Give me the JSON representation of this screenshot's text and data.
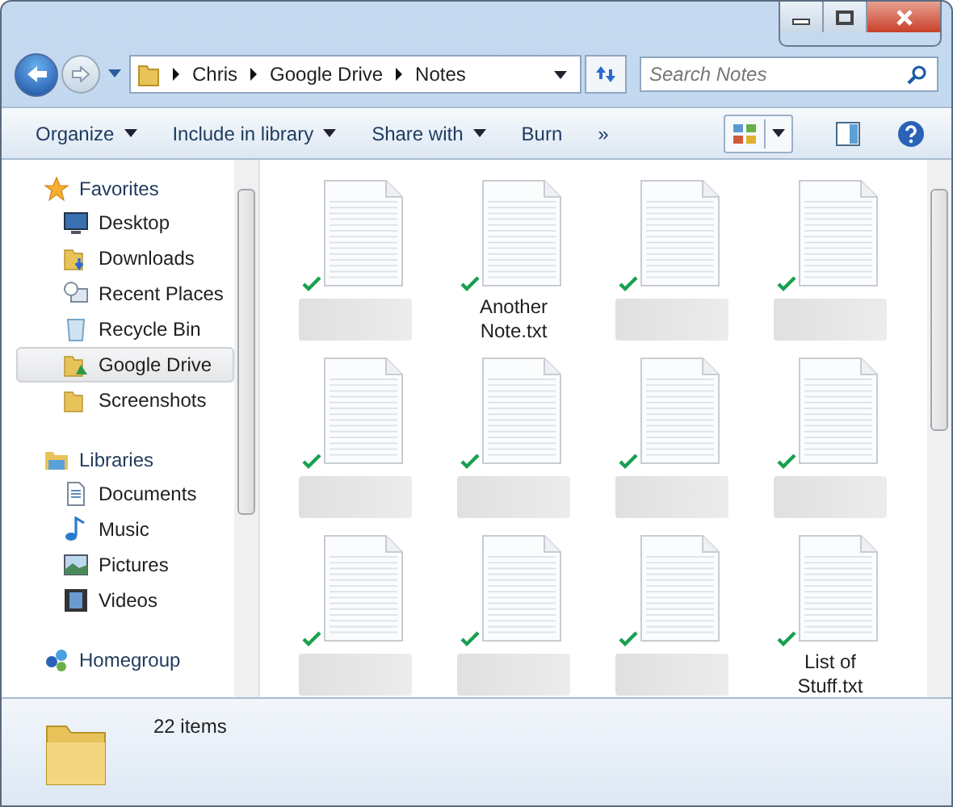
{
  "address": {
    "path": [
      "Chris",
      "Google Drive",
      "Notes"
    ]
  },
  "search": {
    "placeholder": "Search Notes"
  },
  "toolbar": {
    "commands": [
      {
        "label": "Organize",
        "dropdown": true
      },
      {
        "label": "Include in library",
        "dropdown": true
      },
      {
        "label": "Share with",
        "dropdown": true
      },
      {
        "label": "Burn",
        "dropdown": false
      }
    ],
    "overflow": "»"
  },
  "sidebar": {
    "groups": [
      {
        "label": "Favorites",
        "children": [
          {
            "label": "Desktop",
            "selected": false
          },
          {
            "label": "Downloads",
            "selected": false
          },
          {
            "label": "Recent Places",
            "selected": false
          },
          {
            "label": "Recycle Bin",
            "selected": false
          },
          {
            "label": "Google Drive",
            "selected": true
          },
          {
            "label": "Screenshots",
            "selected": false
          }
        ]
      },
      {
        "label": "Libraries",
        "children": [
          {
            "label": "Documents",
            "selected": false
          },
          {
            "label": "Music",
            "selected": false
          },
          {
            "label": "Pictures",
            "selected": false
          },
          {
            "label": "Videos",
            "selected": false
          }
        ]
      },
      {
        "label": "Homegroup"
      }
    ]
  },
  "files": [
    {
      "kind": "redacted",
      "synced": true
    },
    {
      "kind": "named",
      "name": "Another Note.txt",
      "synced": true
    },
    {
      "kind": "redacted",
      "synced": true
    },
    {
      "kind": "redacted",
      "synced": true
    },
    {
      "kind": "redacted",
      "synced": true
    },
    {
      "kind": "redacted",
      "synced": true
    },
    {
      "kind": "redacted",
      "synced": true
    },
    {
      "kind": "redacted",
      "synced": true
    },
    {
      "kind": "redacted",
      "synced": true
    },
    {
      "kind": "redacted",
      "synced": true
    },
    {
      "kind": "redacted",
      "synced": true
    },
    {
      "kind": "named",
      "name": "List of Stuff.txt",
      "synced": true
    }
  ],
  "status": {
    "count": "22 items"
  }
}
